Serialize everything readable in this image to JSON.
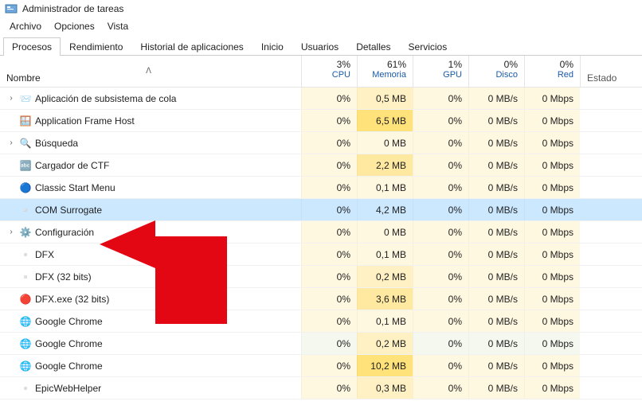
{
  "window": {
    "title": "Administrador de tareas"
  },
  "menu": {
    "archivo": "Archivo",
    "opciones": "Opciones",
    "vista": "Vista"
  },
  "tabs": {
    "procesos": "Procesos",
    "rendimiento": "Rendimiento",
    "historial": "Historial de aplicaciones",
    "inicio": "Inicio",
    "usuarios": "Usuarios",
    "detalles": "Detalles",
    "servicios": "Servicios"
  },
  "columns": {
    "nombre": "Nombre",
    "sort_indicator": "ᐱ",
    "cpu": {
      "pct": "3%",
      "label": "CPU"
    },
    "memoria": {
      "pct": "61%",
      "label": "Memoria"
    },
    "gpu": {
      "pct": "1%",
      "label": "GPU"
    },
    "disco": {
      "pct": "0%",
      "label": "Disco"
    },
    "red": {
      "pct": "0%",
      "label": "Red"
    },
    "estado": "Estado"
  },
  "processes": [
    {
      "expandable": true,
      "icon": "📨",
      "name": "Aplicación de subsistema de cola",
      "cpu": "0%",
      "mem": "0,5 MB",
      "gpu": "0%",
      "disk": "0 MB/s",
      "net": "0 Mbps",
      "selected": false
    },
    {
      "expandable": false,
      "icon": "🪟",
      "name": "Application Frame Host",
      "cpu": "0%",
      "mem": "6,5 MB",
      "gpu": "0%",
      "disk": "0 MB/s",
      "net": "0 Mbps",
      "selected": false
    },
    {
      "expandable": true,
      "icon": "🔍",
      "name": "Búsqueda",
      "cpu": "0%",
      "mem": "0 MB",
      "gpu": "0%",
      "disk": "0 MB/s",
      "net": "0 Mbps",
      "selected": false
    },
    {
      "expandable": false,
      "icon": "🔤",
      "name": "Cargador de CTF",
      "cpu": "0%",
      "mem": "2,2 MB",
      "gpu": "0%",
      "disk": "0 MB/s",
      "net": "0 Mbps",
      "selected": false
    },
    {
      "expandable": false,
      "icon": "🔵",
      "name": "Classic Start Menu",
      "cpu": "0%",
      "mem": "0,1 MB",
      "gpu": "0%",
      "disk": "0 MB/s",
      "net": "0 Mbps",
      "selected": false
    },
    {
      "expandable": false,
      "icon": "▫️",
      "name": "COM Surrogate",
      "cpu": "0%",
      "mem": "4,2 MB",
      "gpu": "0%",
      "disk": "0 MB/s",
      "net": "0 Mbps",
      "selected": true
    },
    {
      "expandable": true,
      "icon": "⚙️",
      "name": "Configuración",
      "cpu": "0%",
      "mem": "0 MB",
      "gpu": "0%",
      "disk": "0 MB/s",
      "net": "0 Mbps",
      "selected": false
    },
    {
      "expandable": false,
      "icon": "▫️",
      "name": "DFX",
      "cpu": "0%",
      "mem": "0,1 MB",
      "gpu": "0%",
      "disk": "0 MB/s",
      "net": "0 Mbps",
      "selected": false
    },
    {
      "expandable": false,
      "icon": "▫️",
      "name": "DFX (32 bits)",
      "cpu": "0%",
      "mem": "0,2 MB",
      "gpu": "0%",
      "disk": "0 MB/s",
      "net": "0 Mbps",
      "selected": false
    },
    {
      "expandable": false,
      "icon": "🔴",
      "name": "DFX.exe (32 bits)",
      "cpu": "0%",
      "mem": "3,6 MB",
      "gpu": "0%",
      "disk": "0 MB/s",
      "net": "0 Mbps",
      "selected": false
    },
    {
      "expandable": false,
      "icon": "🌐",
      "name": "Google Chrome",
      "cpu": "0%",
      "mem": "0,1 MB",
      "gpu": "0%",
      "disk": "0 MB/s",
      "net": "0 Mbps",
      "selected": false
    },
    {
      "expandable": false,
      "icon": "🌐",
      "name": "Google Chrome",
      "cpu": "0%",
      "mem": "0,2 MB",
      "gpu": "0%",
      "disk": "0 MB/s",
      "net": "0 Mbps",
      "selected": false,
      "hover_light": true
    },
    {
      "expandable": false,
      "icon": "🌐",
      "name": "Google Chrome",
      "cpu": "0%",
      "mem": "10,2 MB",
      "gpu": "0%",
      "disk": "0 MB/s",
      "net": "0 Mbps",
      "selected": false
    },
    {
      "expandable": false,
      "icon": "▫️",
      "name": "EpicWebHelper",
      "cpu": "0%",
      "mem": "0,3 MB",
      "gpu": "0%",
      "disk": "0 MB/s",
      "net": "0 Mbps",
      "selected": false
    }
  ]
}
